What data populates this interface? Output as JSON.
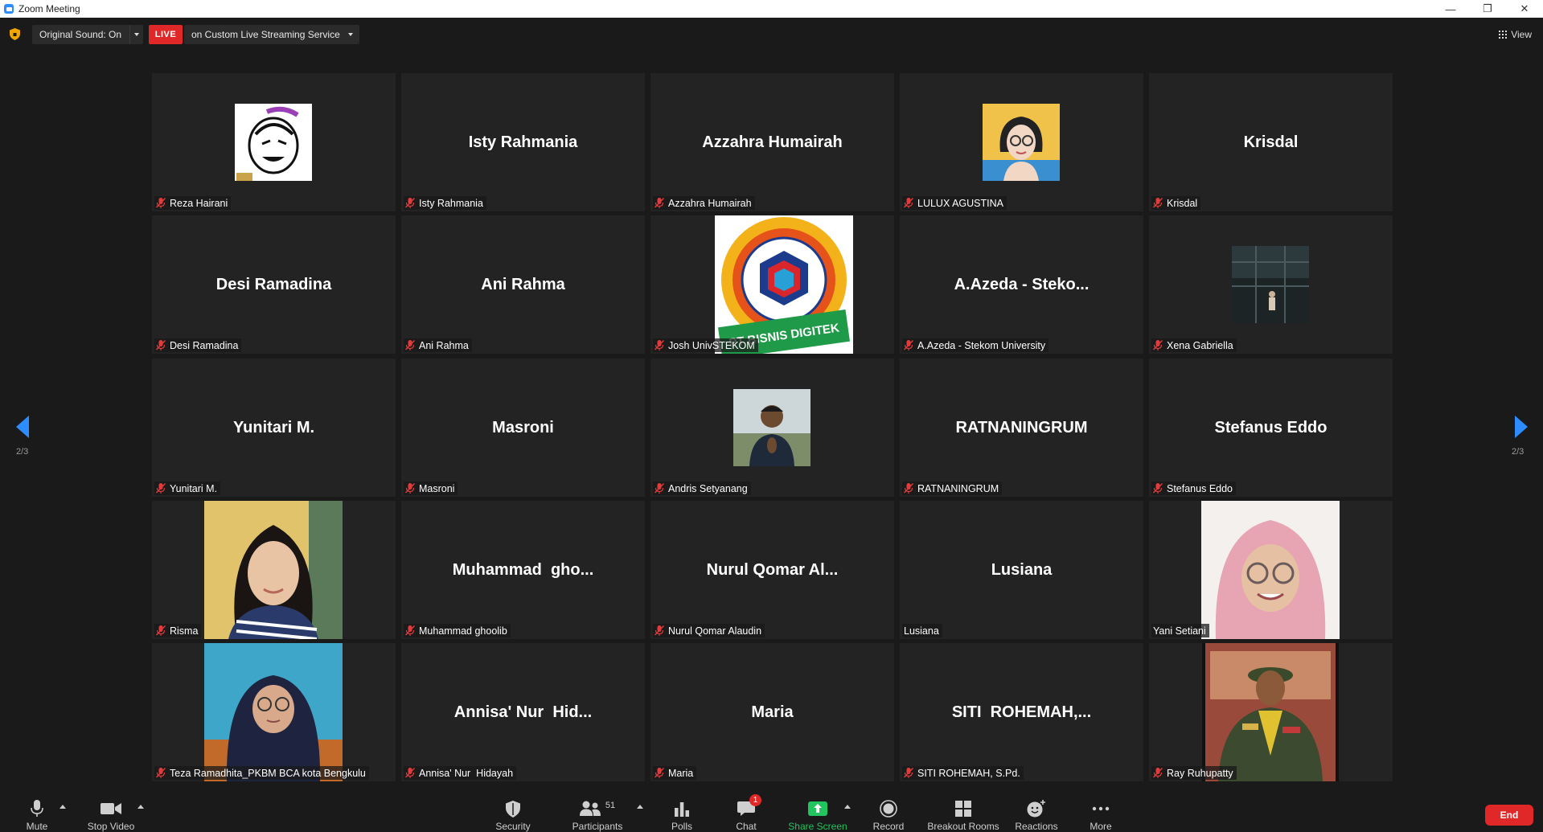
{
  "window": {
    "title": "Zoom Meeting",
    "minimize": "—",
    "restore": "❐",
    "close": "✕"
  },
  "topbar": {
    "original_sound": "Original Sound: On",
    "live_badge": "LIVE",
    "live_service": "on Custom Live Streaming Service",
    "view_label": "View"
  },
  "pagination": {
    "left_page": "2/3",
    "right_page": "2/3"
  },
  "participants": [
    {
      "display": "",
      "name": "Reza Hairani",
      "video": "cartoon"
    },
    {
      "display": "Isty Rahmania",
      "name": "Isty Rahmania"
    },
    {
      "display": "Azzahra Humairah",
      "name": "Azzahra Humairah"
    },
    {
      "display": "",
      "name": "LULUX AGUSTINA",
      "video": "avatar-glasses"
    },
    {
      "display": "Krisdal",
      "name": "Krisdal"
    },
    {
      "display": "Desi Ramadina",
      "name": "Desi Ramadina"
    },
    {
      "display": "Ani Rahma",
      "name": "Ani Rahma"
    },
    {
      "display": "",
      "name": "Josh UnivSTEKOM",
      "video": "logo",
      "logo_text": "PT BISNIS DIGITEK"
    },
    {
      "display": "A.Azeda - Steko...",
      "name": "A.Azeda - Stekom University"
    },
    {
      "display": "",
      "name": "Xena Gabriella",
      "video": "dark-photo"
    },
    {
      "display": "Yunitari M.",
      "name": "Yunitari M."
    },
    {
      "display": "Masroni",
      "name": "Masroni"
    },
    {
      "display": "",
      "name": "Andris Setyanang",
      "video": "person-small"
    },
    {
      "display": "RATNANINGRUM",
      "name": "RATNANINGRUM"
    },
    {
      "display": "Stefanus Eddo",
      "name": "Stefanus Eddo"
    },
    {
      "display": "",
      "name": "Risma",
      "video": "person-hair"
    },
    {
      "display": "Muhammad  gho...",
      "name": "Muhammad ghoolib"
    },
    {
      "display": "Nurul Qomar Al...",
      "name": "Nurul Qomar Alaudin"
    },
    {
      "display": "Lusiana",
      "name": "Lusiana",
      "unmuted": true
    },
    {
      "display": "",
      "name": "Yani Setiani",
      "video": "person-hijab-pink",
      "unmuted": true
    },
    {
      "display": "",
      "name": "Teza Ramadhita_PKBM BCA kota Bengkulu",
      "video": "person-hijab-dark"
    },
    {
      "display": "Annisa' Nur  Hid...",
      "name": "Annisa' Nur  Hidayah"
    },
    {
      "display": "Maria",
      "name": "Maria"
    },
    {
      "display": "SITI  ROHEMAH,...",
      "name": "SITI ROHEMAH, S.Pd."
    },
    {
      "display": "",
      "name": "Ray Ruhupatty",
      "video": "person-uniform"
    }
  ],
  "toolbar": {
    "mute": "Mute",
    "stop_video": "Stop Video",
    "security": "Security",
    "participants": "Participants",
    "participants_count": "51",
    "polls": "Polls",
    "chat": "Chat",
    "chat_badge": "1",
    "share_screen": "Share Screen",
    "record": "Record",
    "breakout_rooms": "Breakout Rooms",
    "reactions": "Reactions",
    "more": "More",
    "end": "End"
  },
  "colors": {
    "accent": "#2d8cff",
    "live": "#e02828",
    "share": "#22c45e",
    "tile": "#232323",
    "background": "#1a1a1a"
  }
}
